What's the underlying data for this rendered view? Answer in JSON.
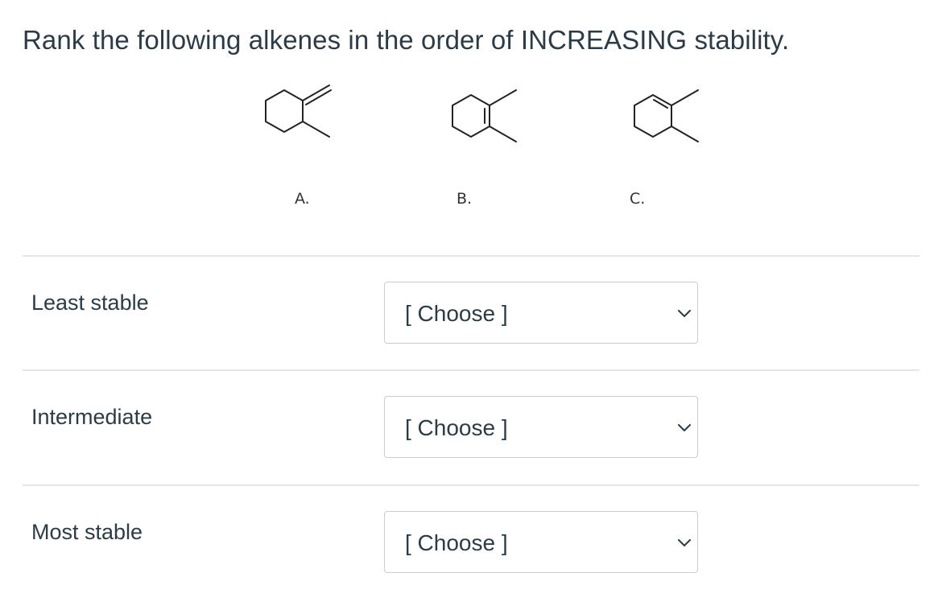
{
  "question": {
    "text": "Rank the following alkenes in the order of INCREASING stability."
  },
  "structures": [
    {
      "label": "A."
    },
    {
      "label": "B."
    },
    {
      "label": "C."
    }
  ],
  "rows": [
    {
      "label": "Least stable",
      "selected": "[ Choose ]"
    },
    {
      "label": "Intermediate",
      "selected": "[ Choose ]"
    },
    {
      "label": "Most stable",
      "selected": "[ Choose ]"
    }
  ],
  "icons": {
    "dropdown": "chevron-down-icon"
  },
  "colors": {
    "text": "#2d3b45",
    "border": "#c7cdd1",
    "divider": "#e3e5e7"
  }
}
